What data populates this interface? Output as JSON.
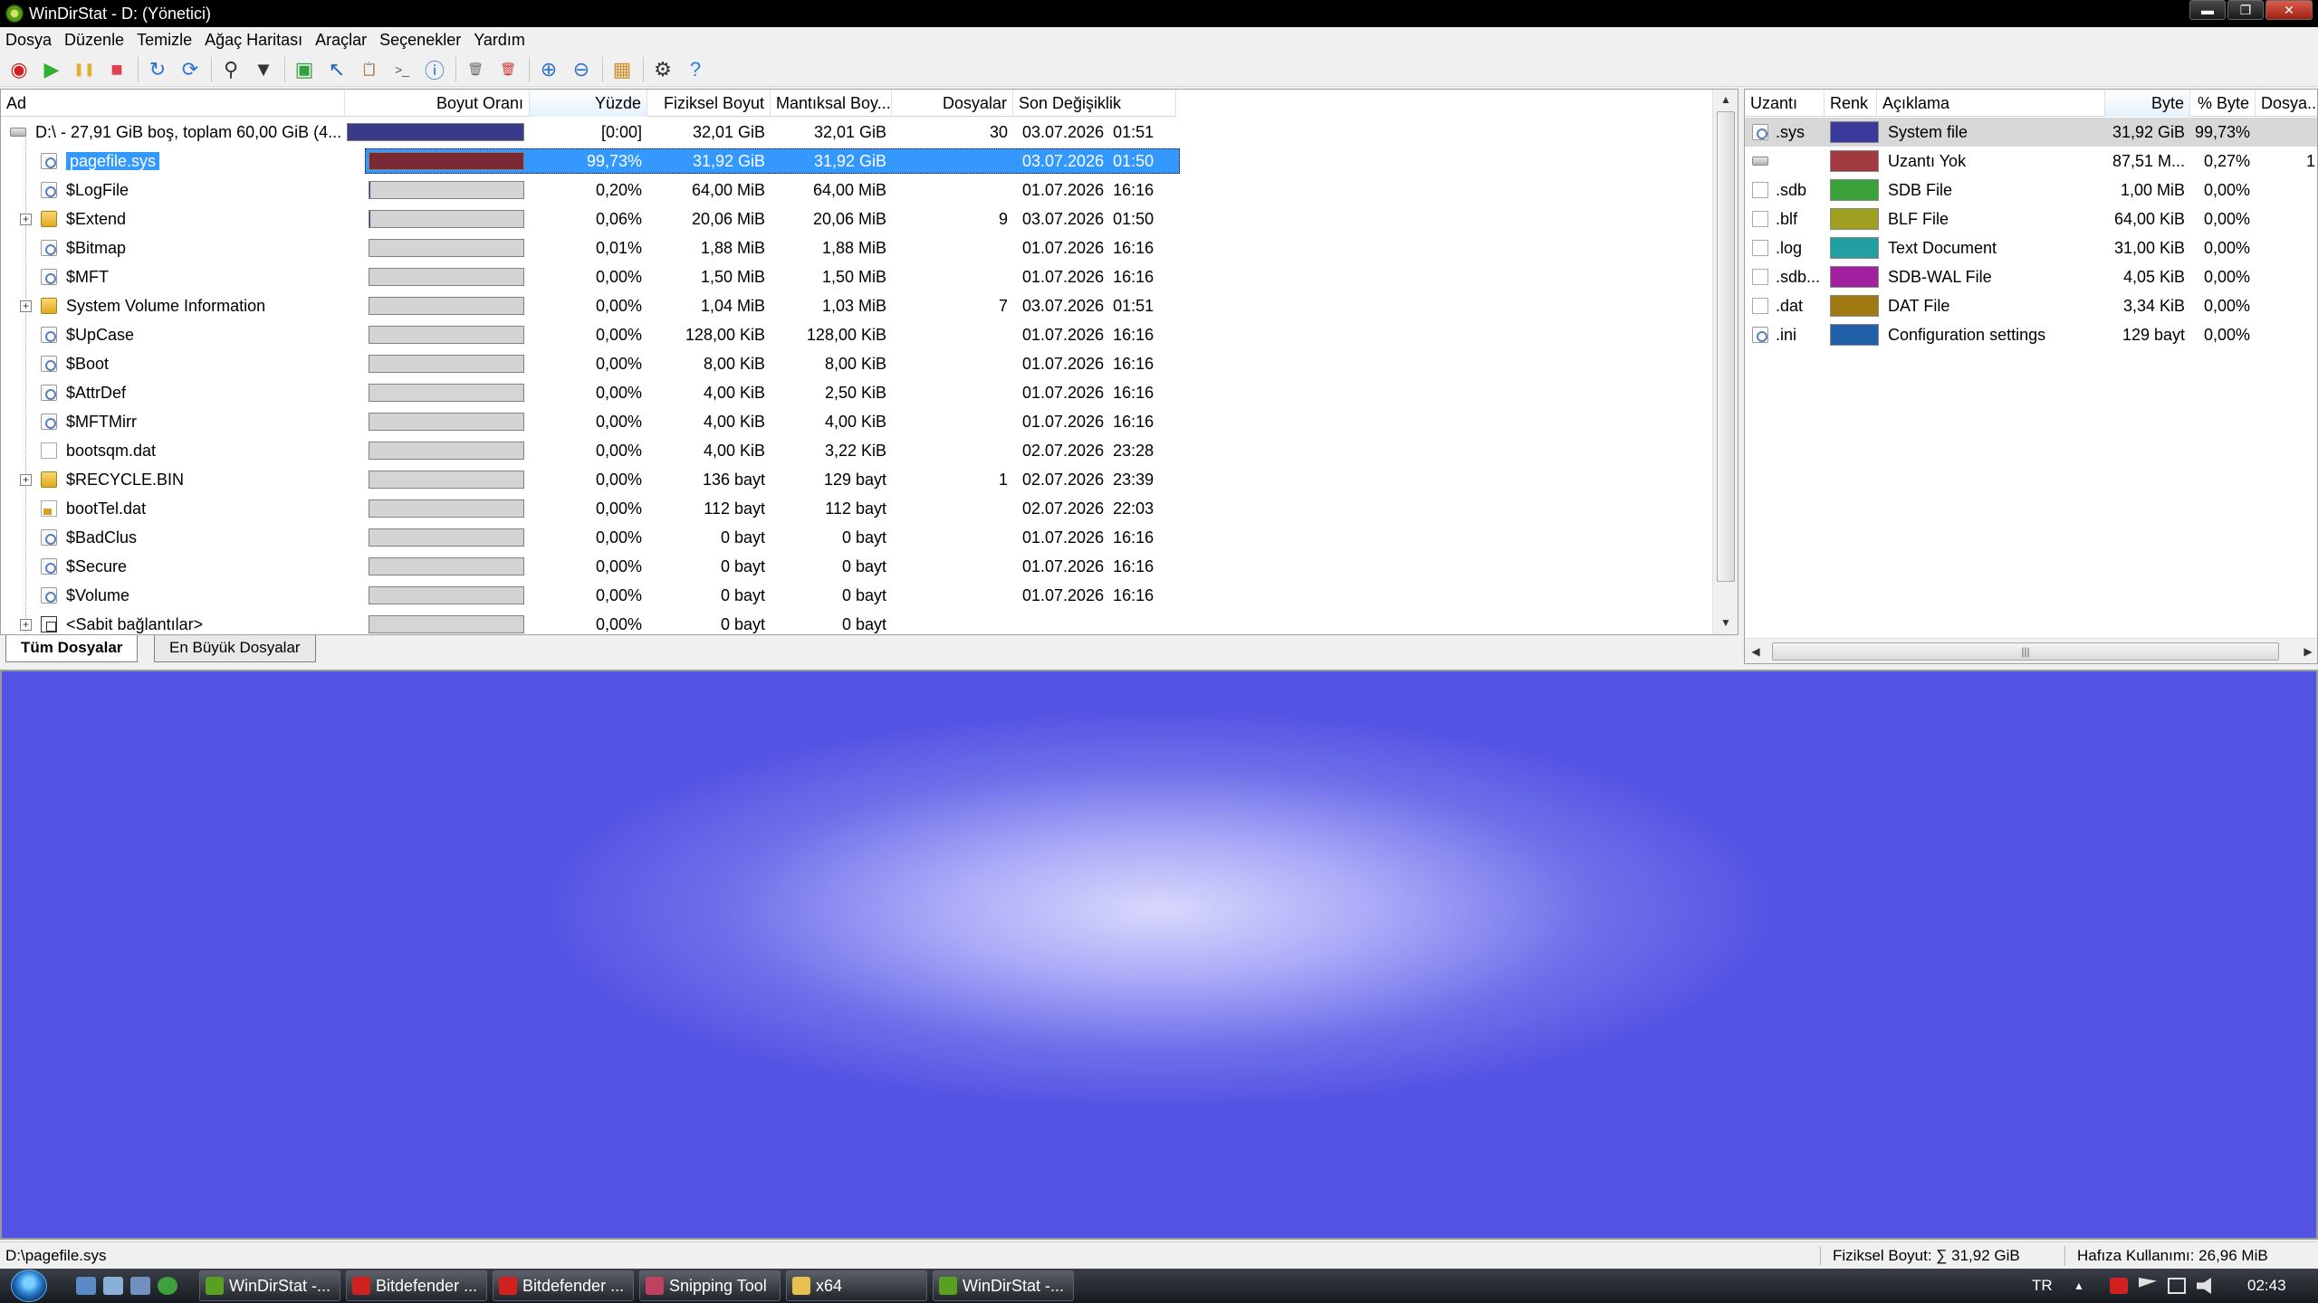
{
  "window": {
    "title": "WinDirStat - D: (Yönetici)",
    "buttons": {
      "minimize": "▬",
      "maximize": "❐",
      "close": "✕"
    }
  },
  "menu": [
    "Dosya",
    "Düzenle",
    "Temizle",
    "Ağaç Haritası",
    "Araçlar",
    "Seçenekler",
    "Yardım"
  ],
  "toolbar": [
    {
      "name": "open-icon",
      "glyph": "◉",
      "color": "#d02020"
    },
    {
      "name": "play-icon",
      "glyph": "▶",
      "color": "#30b030"
    },
    {
      "name": "pause-icon",
      "glyph": "❚❚",
      "color": "#e0b030"
    },
    {
      "name": "stop-icon",
      "glyph": "■",
      "color": "#e04050"
    },
    {
      "name": "refresh-icon",
      "glyph": "↻",
      "color": "#2a70d0"
    },
    {
      "name": "refresh-all-icon",
      "glyph": "⟳",
      "color": "#2a70d0"
    },
    {
      "name": "search-icon",
      "glyph": "⚲",
      "color": "#333333"
    },
    {
      "name": "filter-icon",
      "glyph": "▼",
      "color": "#333333"
    },
    {
      "name": "open-item-icon",
      "glyph": "▣",
      "color": "#30a040"
    },
    {
      "name": "select-icon",
      "glyph": "↖",
      "color": "#2060c0"
    },
    {
      "name": "copy-path-icon",
      "glyph": "📋",
      "color": "#c08020"
    },
    {
      "name": "command-prompt-icon",
      "glyph": ">_",
      "color": "#555555"
    },
    {
      "name": "properties-icon",
      "glyph": "ⓘ",
      "color": "#2a70d0"
    },
    {
      "name": "recycle-icon",
      "glyph": "🗑",
      "color": "#666666"
    },
    {
      "name": "delete-icon",
      "glyph": "🗑",
      "color": "#d03030"
    },
    {
      "name": "zoom-in-icon",
      "glyph": "⊕",
      "color": "#2a70d0"
    },
    {
      "name": "zoom-out-icon",
      "glyph": "⊖",
      "color": "#2a70d0"
    },
    {
      "name": "treemap-icon",
      "glyph": "▦",
      "color": "#d09030"
    },
    {
      "name": "settings-icon",
      "glyph": "⚙",
      "color": "#333333"
    },
    {
      "name": "help-icon",
      "glyph": "?",
      "color": "#2a80e0"
    }
  ],
  "tree": {
    "headers": [
      "Ad",
      "Boyut Oranı",
      "Yüzde",
      "Fiziksel Boyut",
      "Mantıksal Boy...",
      "Dosyalar",
      "Son Değişiklik"
    ],
    "rows": [
      {
        "name": "D:\\ - 27,91 GiB boş, toplam 60,00 GiB (4...",
        "icon": "drive",
        "level": 0,
        "expander": "",
        "ratio": 1.0,
        "fill": "#3a3a8a",
        "percent": "[0:00]",
        "physical": "32,01 GiB",
        "logical": "32,01 GiB",
        "files": "30",
        "modified": "03.07.2026  01:51"
      },
      {
        "name": "pagefile.sys",
        "icon": "sys",
        "level": 1,
        "expander": "",
        "ratio": 0.9973,
        "fill": "#7a2a32",
        "percent": "99,73%",
        "physical": "31,92 GiB",
        "logical": "31,92 GiB",
        "files": "",
        "modified": "03.07.2026  01:50",
        "selected": true
      },
      {
        "name": "$LogFile",
        "icon": "sys",
        "level": 1,
        "expander": "",
        "ratio": 0.002,
        "fill": "#3a3a8a",
        "percent": "0,20%",
        "physical": "64,00 MiB",
        "logical": "64,00 MiB",
        "files": "",
        "modified": "01.07.2026  16:16"
      },
      {
        "name": "$Extend",
        "icon": "folder",
        "level": 1,
        "expander": "+",
        "ratio": 0.0006,
        "fill": "#3a3a8a",
        "percent": "0,06%",
        "physical": "20,06 MiB",
        "logical": "20,06 MiB",
        "files": "9",
        "modified": "03.07.2026  01:50"
      },
      {
        "name": "$Bitmap",
        "icon": "sys",
        "level": 1,
        "expander": "",
        "ratio": 0.0001,
        "fill": "#3a3a8a",
        "percent": "0,01%",
        "physical": "1,88 MiB",
        "logical": "1,88 MiB",
        "files": "",
        "modified": "01.07.2026  16:16"
      },
      {
        "name": "$MFT",
        "icon": "sys",
        "level": 1,
        "expander": "",
        "ratio": 0,
        "fill": "#3a3a8a",
        "percent": "0,00%",
        "physical": "1,50 MiB",
        "logical": "1,50 MiB",
        "files": "",
        "modified": "01.07.2026  16:16"
      },
      {
        "name": "System Volume Information",
        "icon": "folder",
        "level": 1,
        "expander": "+",
        "ratio": 0,
        "fill": "#3a3a8a",
        "percent": "0,00%",
        "physical": "1,04 MiB",
        "logical": "1,03 MiB",
        "files": "7",
        "modified": "03.07.2026  01:51"
      },
      {
        "name": "$UpCase",
        "icon": "sys",
        "level": 1,
        "expander": "",
        "ratio": 0,
        "fill": "#3a3a8a",
        "percent": "0,00%",
        "physical": "128,00 KiB",
        "logical": "128,00 KiB",
        "files": "",
        "modified": "01.07.2026  16:16"
      },
      {
        "name": "$Boot",
        "icon": "sys",
        "level": 1,
        "expander": "",
        "ratio": 0,
        "fill": "#3a3a8a",
        "percent": "0,00%",
        "physical": "8,00 KiB",
        "logical": "8,00 KiB",
        "files": "",
        "modified": "01.07.2026  16:16"
      },
      {
        "name": "$AttrDef",
        "icon": "sys",
        "level": 1,
        "expander": "",
        "ratio": 0,
        "fill": "#3a3a8a",
        "percent": "0,00%",
        "physical": "4,00 KiB",
        "logical": "2,50 KiB",
        "files": "",
        "modified": "01.07.2026  16:16"
      },
      {
        "name": "$MFTMirr",
        "icon": "sys",
        "level": 1,
        "expander": "",
        "ratio": 0,
        "fill": "#3a3a8a",
        "percent": "0,00%",
        "physical": "4,00 KiB",
        "logical": "4,00 KiB",
        "files": "",
        "modified": "01.07.2026  16:16"
      },
      {
        "name": "bootsqm.dat",
        "icon": "doc",
        "level": 1,
        "expander": "",
        "ratio": 0,
        "fill": "#3a3a8a",
        "percent": "0,00%",
        "physical": "4,00 KiB",
        "logical": "3,22 KiB",
        "files": "",
        "modified": "02.07.2026  23:28"
      },
      {
        "name": "$RECYCLE.BIN",
        "icon": "folder",
        "level": 1,
        "expander": "+",
        "ratio": 0,
        "fill": "#3a3a8a",
        "percent": "0,00%",
        "physical": "136 bayt",
        "logical": "129 bayt",
        "files": "1",
        "modified": "02.07.2026  23:39"
      },
      {
        "name": "bootTel.dat",
        "icon": "lock",
        "level": 1,
        "expander": "",
        "ratio": 0,
        "fill": "#3a3a8a",
        "percent": "0,00%",
        "physical": "112 bayt",
        "logical": "112 bayt",
        "files": "",
        "modified": "02.07.2026  22:03"
      },
      {
        "name": "$BadClus",
        "icon": "sys",
        "level": 1,
        "expander": "",
        "ratio": 0,
        "fill": "#3a3a8a",
        "percent": "0,00%",
        "physical": "0 bayt",
        "logical": "0 bayt",
        "files": "",
        "modified": "01.07.2026  16:16"
      },
      {
        "name": "$Secure",
        "icon": "sys",
        "level": 1,
        "expander": "",
        "ratio": 0,
        "fill": "#3a3a8a",
        "percent": "0,00%",
        "physical": "0 bayt",
        "logical": "0 bayt",
        "files": "",
        "modified": "01.07.2026  16:16"
      },
      {
        "name": "$Volume",
        "icon": "sys",
        "level": 1,
        "expander": "",
        "ratio": 0,
        "fill": "#3a3a8a",
        "percent": "0,00%",
        "physical": "0 bayt",
        "logical": "0 bayt",
        "files": "",
        "modified": "01.07.2026  16:16"
      },
      {
        "name": "<Sabit bağlantılar>",
        "icon": "links",
        "level": 1,
        "expander": "+",
        "ratio": 0,
        "fill": "#3a3a8a",
        "percent": "0,00%",
        "physical": "0 bayt",
        "logical": "0 bayt",
        "files": "",
        "modified": ""
      }
    ]
  },
  "tabs": [
    "Tüm Dosyalar",
    "En Büyük Dosyalar"
  ],
  "extensions": {
    "headers": [
      "Uzantı",
      "Renk",
      "Açıklama",
      "Byte",
      "% Byte",
      "Dosya..."
    ],
    "rows": [
      {
        "ext": ".sys",
        "color": "#3a3a9a",
        "desc": "System file",
        "bytes": "31,92 GiB",
        "pct": "99,73%",
        "files": "",
        "selected": true
      },
      {
        "ext": "",
        "color": "#a03a40",
        "desc": "Uzantı Yok",
        "bytes": "87,51 M...",
        "pct": "0,27%",
        "files": "1"
      },
      {
        "ext": ".sdb",
        "color": "#3aa03a",
        "desc": "SDB File",
        "bytes": "1,00 MiB",
        "pct": "0,00%",
        "files": ""
      },
      {
        "ext": ".blf",
        "color": "#a0a020",
        "desc": "BLF File",
        "bytes": "64,00 KiB",
        "pct": "0,00%",
        "files": ""
      },
      {
        "ext": ".log",
        "color": "#20a0a0",
        "desc": "Text Document",
        "bytes": "31,00 KiB",
        "pct": "0,00%",
        "files": ""
      },
      {
        "ext": ".sdb...",
        "color": "#a020a0",
        "desc": "SDB-WAL File",
        "bytes": "4,05 KiB",
        "pct": "0,00%",
        "files": ""
      },
      {
        "ext": ".dat",
        "color": "#a07a10",
        "desc": "DAT File",
        "bytes": "3,34 KiB",
        "pct": "0,00%",
        "files": ""
      },
      {
        "ext": ".ini",
        "color": "#2060a8",
        "desc": "Configuration settings",
        "bytes": "129 bayt",
        "pct": "0,00%",
        "files": ""
      }
    ]
  },
  "status": {
    "path": "D:\\pagefile.sys",
    "physical": "Fiziksel Boyut: ∑ 31,92 GiB",
    "memory": "Hafıza Kullanımı: 26,96 MiB"
  },
  "taskbar": {
    "tasks": [
      {
        "label": "WinDirStat -...",
        "color": "#5aa020"
      },
      {
        "label": "Bitdefender ...",
        "color": "#d02020"
      },
      {
        "label": "Bitdefender ...",
        "color": "#d02020"
      },
      {
        "label": "Snipping Tool",
        "color": "#c04060"
      },
      {
        "label": "x64",
        "color": "#e8c050"
      },
      {
        "label": "WinDirStat -...",
        "color": "#5aa020"
      }
    ],
    "language": "TR",
    "time": "02:43"
  }
}
